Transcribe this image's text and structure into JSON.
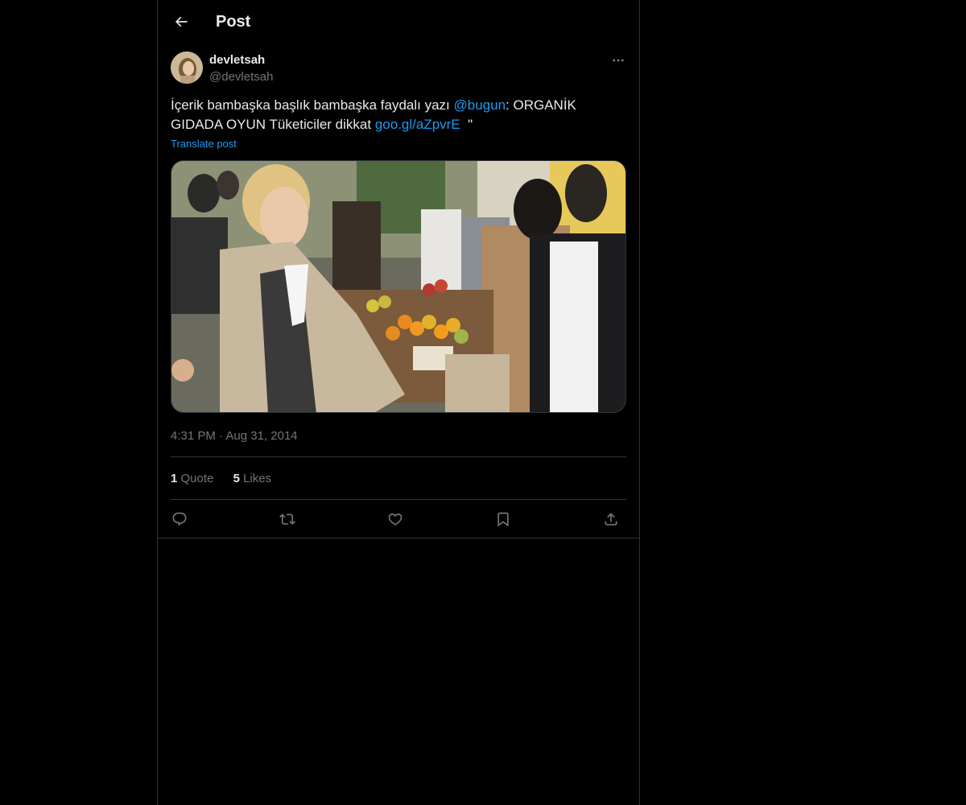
{
  "header": {
    "title": "Post",
    "back_icon": "arrow-left-icon"
  },
  "author": {
    "name": "devletsah",
    "handle": "@devletsah",
    "avatar_icon": "avatar-photo"
  },
  "more_icon": "ellipsis-icon",
  "post": {
    "text_part1": "İçerik bambaşka başlık bambaşka faydalı yazı ",
    "mention": "@bugun",
    "text_part2": ": ORGANİK GIDADA OYUN Tüketiciler dikkat ",
    "link": "goo.gl/aZpvrE",
    "text_part3": "  \"",
    "translate_label": "Translate post"
  },
  "media": {
    "type": "photo"
  },
  "meta": {
    "time": "4:31 PM",
    "separator": "·",
    "date": "Aug 31, 2014"
  },
  "stats": {
    "quotes_count": "1",
    "quotes_label": "Quote",
    "likes_count": "5",
    "likes_label": "Likes"
  },
  "actions": {
    "reply_icon": "reply-icon",
    "repost_icon": "repost-icon",
    "like_icon": "heart-icon",
    "bookmark_icon": "bookmark-icon",
    "share_icon": "share-icon"
  },
  "colors": {
    "background": "#000000",
    "text_primary": "#e7e9ea",
    "text_secondary": "#71767b",
    "link": "#1d9bf0",
    "border": "#2f3336"
  }
}
